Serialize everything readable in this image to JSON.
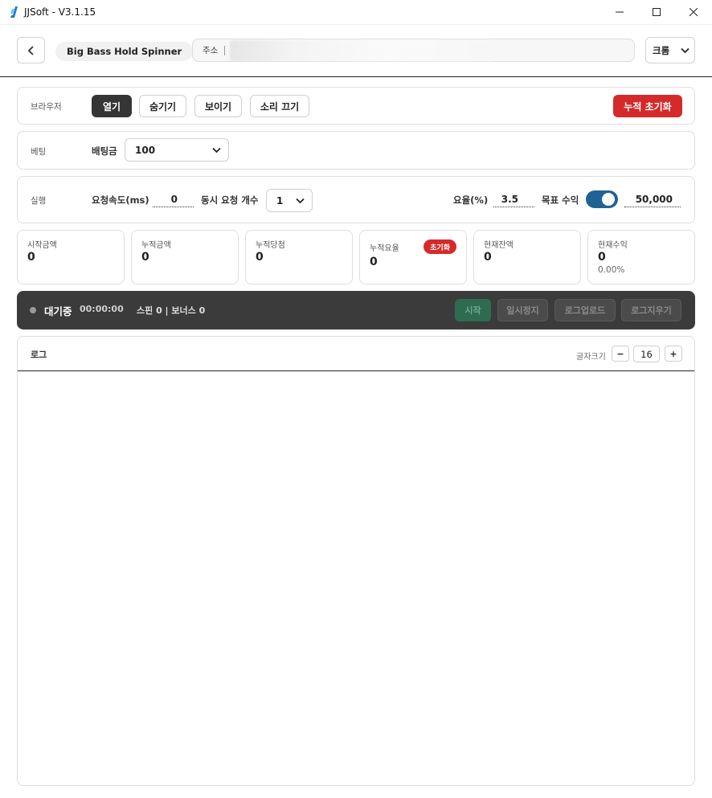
{
  "window": {
    "title": "JJSoft - V3.1.15"
  },
  "topbar": {
    "page_name": "Big Bass Hold Spinner",
    "address_label": "주소",
    "browser_selected": "크롬"
  },
  "browser_row": {
    "label": "브라우저",
    "open": "열기",
    "hide": "숨기기",
    "show": "보이기",
    "mute": "소리 끄기",
    "reset_total": "누적 초기화"
  },
  "betting_row": {
    "label": "베팅",
    "amount_label": "배팅금",
    "amount_value": "100"
  },
  "run_row": {
    "label": "실행",
    "speed_label": "요청속도(ms)",
    "speed_value": "0",
    "concurrent_label": "동시 요청 개수",
    "concurrent_value": "1",
    "rate_label": "요율(%)",
    "rate_value": "3.5",
    "target_label": "목표 수익",
    "target_enabled": true,
    "target_value": "50,000"
  },
  "stats": [
    {
      "label": "시작금액",
      "value": "0"
    },
    {
      "label": "누적금액",
      "value": "0"
    },
    {
      "label": "누적당첨",
      "value": "0"
    },
    {
      "label": "누적요율",
      "value": "0",
      "badge": "초기화"
    },
    {
      "label": "현재잔액",
      "value": "0"
    },
    {
      "label": "현재수익",
      "value": "0",
      "sub": "0.00%"
    }
  ],
  "status": {
    "state": "대기중",
    "elapsed": "00:00:00",
    "spin_info": "스핀 0 | 보너스 0",
    "start": "시작",
    "pause": "일시정지",
    "upload_log": "로그업로드",
    "clear_log": "로그지우기"
  },
  "log": {
    "title": "로그",
    "font_size_label": "글자크기",
    "decrease": "−",
    "font_size": "16",
    "increase": "+"
  },
  "colors": {
    "accent_red": "#d42a2a",
    "toggle_blue": "#1f6394",
    "status_bg": "#3b3b3b",
    "start_green": "#2f6b50"
  }
}
